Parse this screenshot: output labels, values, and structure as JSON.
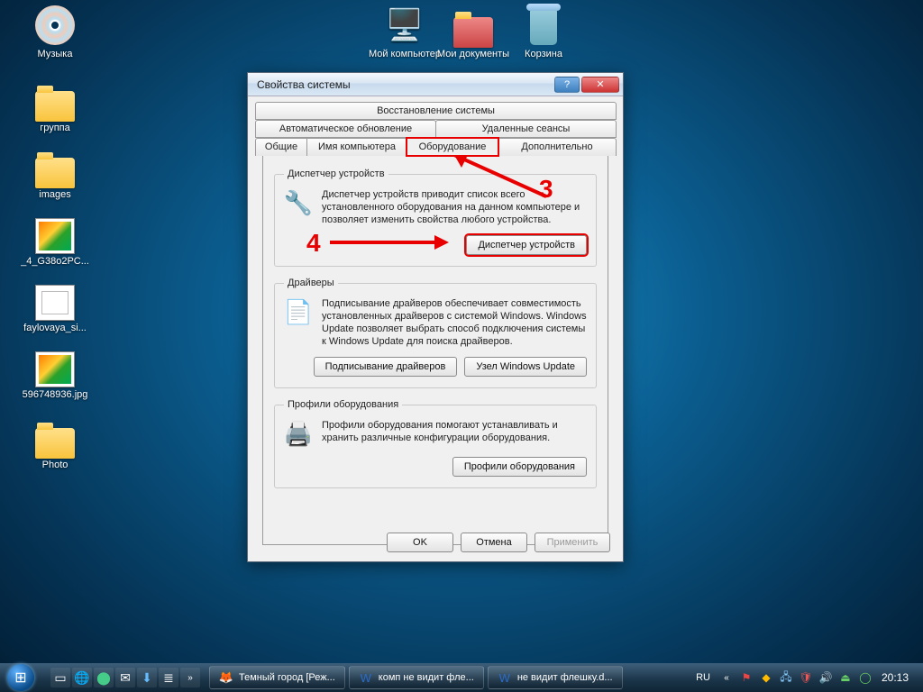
{
  "desktop_icons": {
    "music": "Музыка",
    "mycomputer": "Мой компьютер",
    "mydocs": "Мои документы",
    "recycle": "Корзина",
    "group": "группа",
    "images": "images",
    "file_4g38": "_4_G38o2PC...",
    "file_fayl": "faylovaya_si...",
    "file_596": "596748936.jpg",
    "photo": "Photo"
  },
  "dialog": {
    "title": "Свойства системы",
    "tabs": {
      "restore": "Восстановление системы",
      "autoupdate": "Автоматическое обновление",
      "remote": "Удаленные сеансы",
      "general": "Общие",
      "computer_name": "Имя компьютера",
      "hardware": "Оборудование",
      "advanced": "Дополнительно"
    },
    "groups": {
      "devmgr": {
        "legend": "Диспетчер устройств",
        "desc": "Диспетчер устройств приводит список всего установленного оборудования на данном компьютере и позволяет изменить свойства любого устройства.",
        "button": "Диспетчер устройств"
      },
      "drivers": {
        "legend": "Драйверы",
        "desc": "Подписывание драйверов обеспечивает совместимость установленных драйверов с системой Windows.  Windows Update позволяет выбрать способ подключения системы к Windows Update для поиска драйверов.",
        "btn_sign": "Подписывание драйверов",
        "btn_wu": "Узел Windows Update"
      },
      "profiles": {
        "legend": "Профили оборудования",
        "desc": "Профили оборудования помогают устанавливать и хранить различные конфигурации оборудования.",
        "button": "Профили оборудования"
      }
    },
    "buttons": {
      "ok": "OK",
      "cancel": "Отмена",
      "apply": "Применить"
    }
  },
  "annotations": {
    "n3": "3",
    "n4": "4"
  },
  "taskbar": {
    "tasks": [
      "Темный город [Реж...",
      "комп не видит фле...",
      "не видит флешку.d..."
    ],
    "lang": "RU",
    "clock": "20:13"
  }
}
